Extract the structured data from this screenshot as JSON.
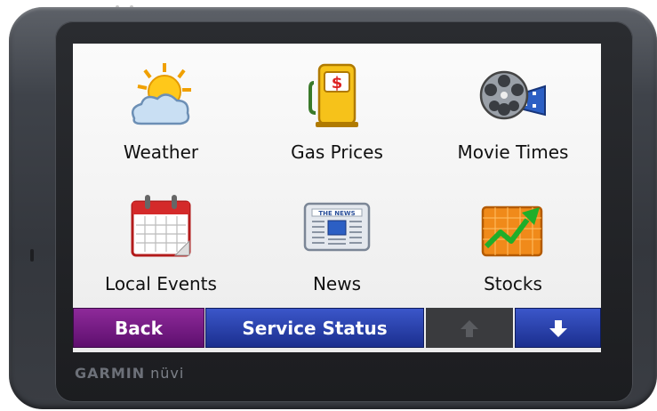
{
  "device": {
    "brand": "GARMIN",
    "model": "nüvi"
  },
  "menu": {
    "tiles": [
      {
        "label": "Weather",
        "icon": "weather-icon"
      },
      {
        "label": "Gas Prices",
        "icon": "gas-pump-icon"
      },
      {
        "label": "Movie Times",
        "icon": "film-reel-icon"
      },
      {
        "label": "Local Events",
        "icon": "calendar-icon"
      },
      {
        "label": "News",
        "icon": "newspaper-icon"
      },
      {
        "label": "Stocks",
        "icon": "stock-chart-icon"
      }
    ],
    "gas_sign": "$",
    "news_header": "THE NEWS"
  },
  "bottom_bar": {
    "back_label": "Back",
    "status_label": "Service Status",
    "up_icon": "arrow-up-icon",
    "down_icon": "arrow-down-icon"
  },
  "colors": {
    "back": "#7a1f88",
    "status": "#2a43b0",
    "down": "#2a43b0",
    "up_disabled": "#3a3b3e"
  }
}
